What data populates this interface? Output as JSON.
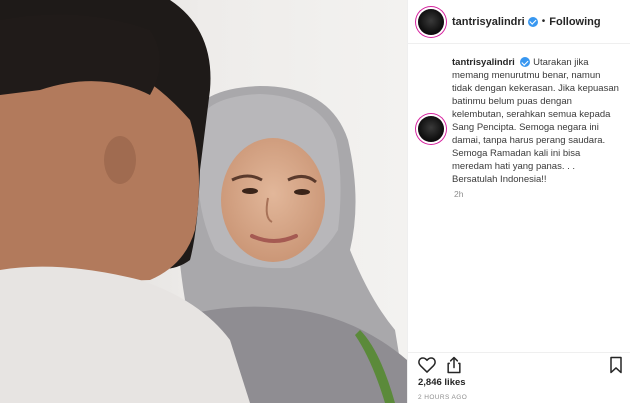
{
  "post": {
    "username": "tantrisyalindri",
    "follow_status": "Following",
    "separator": "•",
    "caption": "Utarakan jika memang menurutmu benar, namun tidak dengan kekerasan. Jika kepuasan batinmu belum puas dengan kelembutan, serahkan semua kepada Sang Pencipta. Semoga negara ini damai, tanpa harus perang saudara.\nSemoga Ramadan kali ini bisa meredam hati yang panas. . .\nBersatulah Indonesia!!",
    "time_ago": "2h",
    "likes": "2,846 likes",
    "posted": "2 HOURS AGO"
  },
  "icons": {
    "verified": "verified-badge-icon",
    "like": "heart-icon",
    "share": "share-icon",
    "save": "bookmark-icon"
  },
  "colors": {
    "verified_blue": "#3897f0",
    "story_ring": "#d6249f",
    "muted": "#8e8e8e"
  }
}
